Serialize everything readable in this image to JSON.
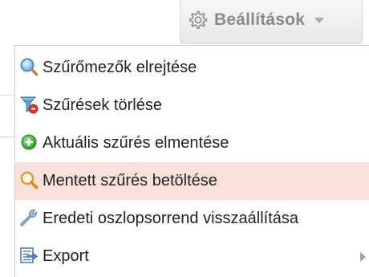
{
  "settings": {
    "label": "Beállítások",
    "icon": "gear-icon",
    "caret_icon": "caret-down-icon"
  },
  "menu": {
    "items": [
      {
        "label": "Szűrőmezők elrejtése",
        "icon": "magnifier-icon",
        "active": false
      },
      {
        "label": "Szűrések törlése",
        "icon": "filter-remove-icon",
        "active": false
      },
      {
        "label": "Aktuális szűrés elmentése",
        "icon": "add-circle-icon",
        "active": false
      },
      {
        "label": "Mentett szűrés betöltése",
        "icon": "search-icon",
        "active": true
      },
      {
        "label": "Eredeti oszlopsorrend visszaállítása",
        "icon": "wrench-icon",
        "active": false
      },
      {
        "label": "Export",
        "icon": "export-icon",
        "active": false,
        "submenu": true
      }
    ]
  },
  "colors": {
    "active_background": "#f8e1d8",
    "text": "#222222",
    "button_text": "#8a8a8a"
  }
}
